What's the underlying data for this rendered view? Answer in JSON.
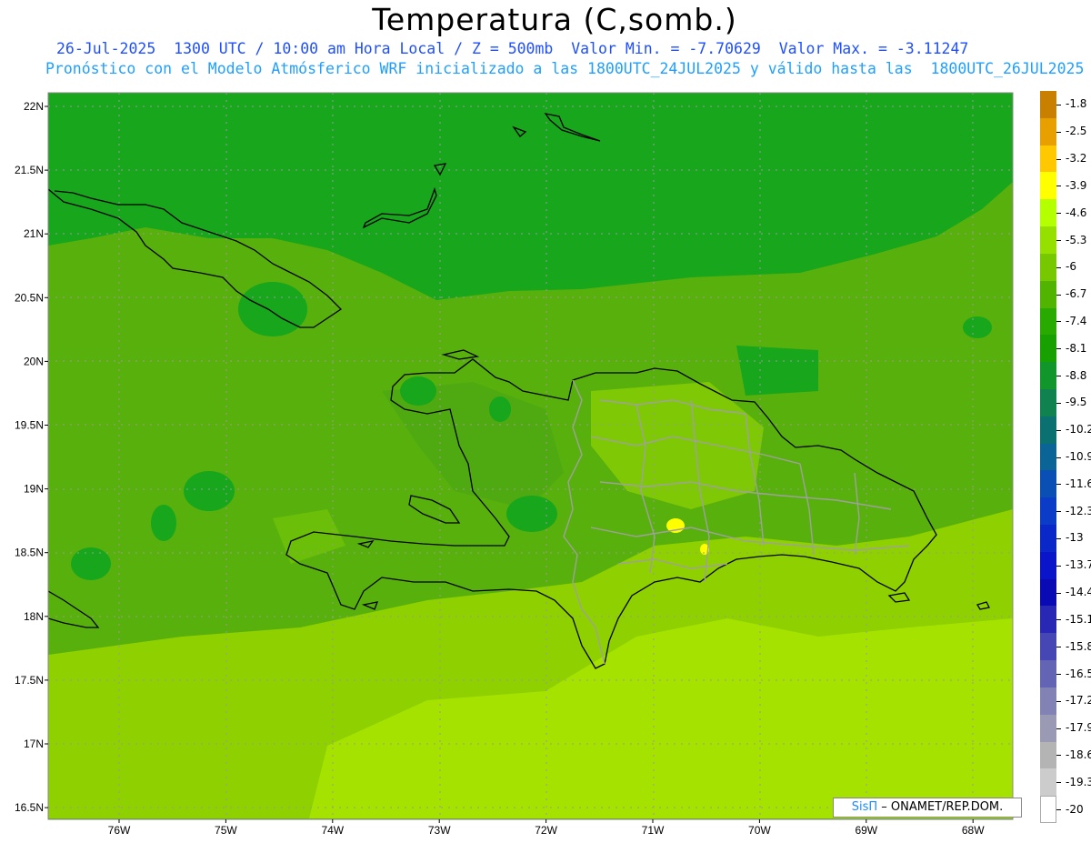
{
  "header": {
    "title": "Temperatura (C,somb.)",
    "line1": "26-Jul-2025  1300 UTC / 10:00 am Hora Local / Z = 500mb  Valor Min. = -7.70629  Valor Max. = -3.11247",
    "line2": "Pronóstico con el Modelo Atmósferico WRF inicializado a las 1800UTC_24JUL2025 y válido hasta las  1800UTC_26JUL2025"
  },
  "axes": {
    "lat_labels": [
      "22N",
      "21.5N",
      "21N",
      "20.5N",
      "20N",
      "19.5N",
      "19N",
      "18.5N",
      "18N",
      "17.5N",
      "17N",
      "16.5N"
    ],
    "lon_labels": [
      "76W",
      "75W",
      "74W",
      "73W",
      "72W",
      "71W",
      "70W",
      "69W",
      "68W"
    ]
  },
  "legend": {
    "labels": [
      "-1.8",
      "-2.5",
      "-3.2",
      "-3.9",
      "-4.6",
      "-5.3",
      "-6",
      "-6.7",
      "-7.4",
      "-8.1",
      "-8.8",
      "-9.5",
      "-10.2",
      "-10.9",
      "-11.6",
      "-12.3",
      "-13",
      "-13.7",
      "-14.4",
      "-15.1",
      "-15.8",
      "-16.5",
      "-17.2",
      "-17.9",
      "-18.6",
      "-19.3",
      "-20"
    ],
    "colors": [
      "#c98000",
      "#e8a000",
      "#ffc800",
      "#ffff00",
      "#b4ff00",
      "#96e000",
      "#78c800",
      "#50b400",
      "#28aa00",
      "#18a000",
      "#10962a",
      "#108250",
      "#0a7070",
      "#0a6496",
      "#0a50b4",
      "#0a3cc8",
      "#0a28c8",
      "#0a14c8",
      "#0a0ab4",
      "#2828b4",
      "#4646b4",
      "#6464b4",
      "#8282b4",
      "#9a9ab4",
      "#b4b4b4",
      "#cccccc",
      "#ffffff"
    ]
  },
  "credit": {
    "brand": "SisΠ",
    "text": "– ONAMET/REP.DOM."
  },
  "colors": {
    "bg_north": "#17a61c",
    "bg_mid": "#58b00c",
    "bg_south": "#8ed000",
    "bg_far_south": "#a6e200",
    "hotspot": "#ffff00",
    "coast": "#000000",
    "provinces": "#9e9e9e"
  }
}
